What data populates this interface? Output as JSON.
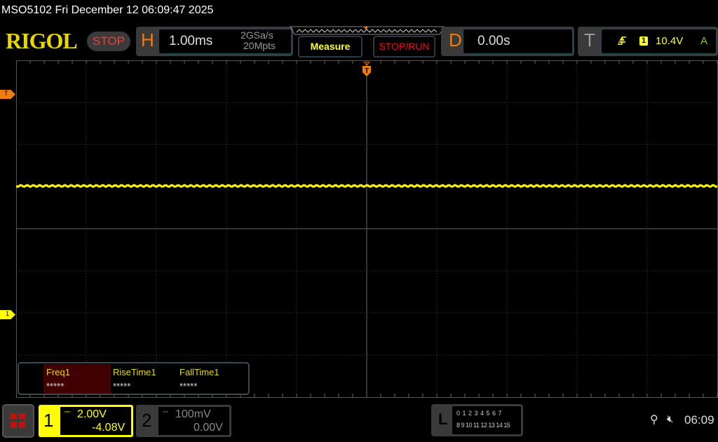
{
  "titlebar": {
    "text": "MSO5102  Fri December 12 06:09:47 2025"
  },
  "logo": "RIGOL",
  "status": "STOP",
  "horizontal": {
    "label": "H",
    "timebase": "1.00ms",
    "sample_rate": "2GSa/s",
    "memory": "20Mpts"
  },
  "buttons": {
    "measure": "Measure",
    "stop_run": "STOP/RUN"
  },
  "delay": {
    "label": "D",
    "value": "0.00s"
  },
  "trigger": {
    "label": "T",
    "source": "1",
    "level": "10.4V",
    "mode": "A",
    "marker": "T"
  },
  "channel1_marker": "1",
  "measurements": [
    {
      "name": "Freq1",
      "value": "*****"
    },
    {
      "name": "RiseTime1",
      "value": "*****"
    },
    {
      "name": "FallTime1",
      "value": "*****"
    }
  ],
  "ch1": {
    "num": "1",
    "scale": "2.00V",
    "offset": "-4.08V",
    "color": "#ffff00"
  },
  "ch2": {
    "num": "2",
    "scale": "100mV",
    "offset": "0.00V"
  },
  "logic": {
    "label": "L",
    "row1": "0 1 2 3  4 5 6 7",
    "row2": "8 9 10 11 12 13 14 15"
  },
  "clock": "06:09"
}
